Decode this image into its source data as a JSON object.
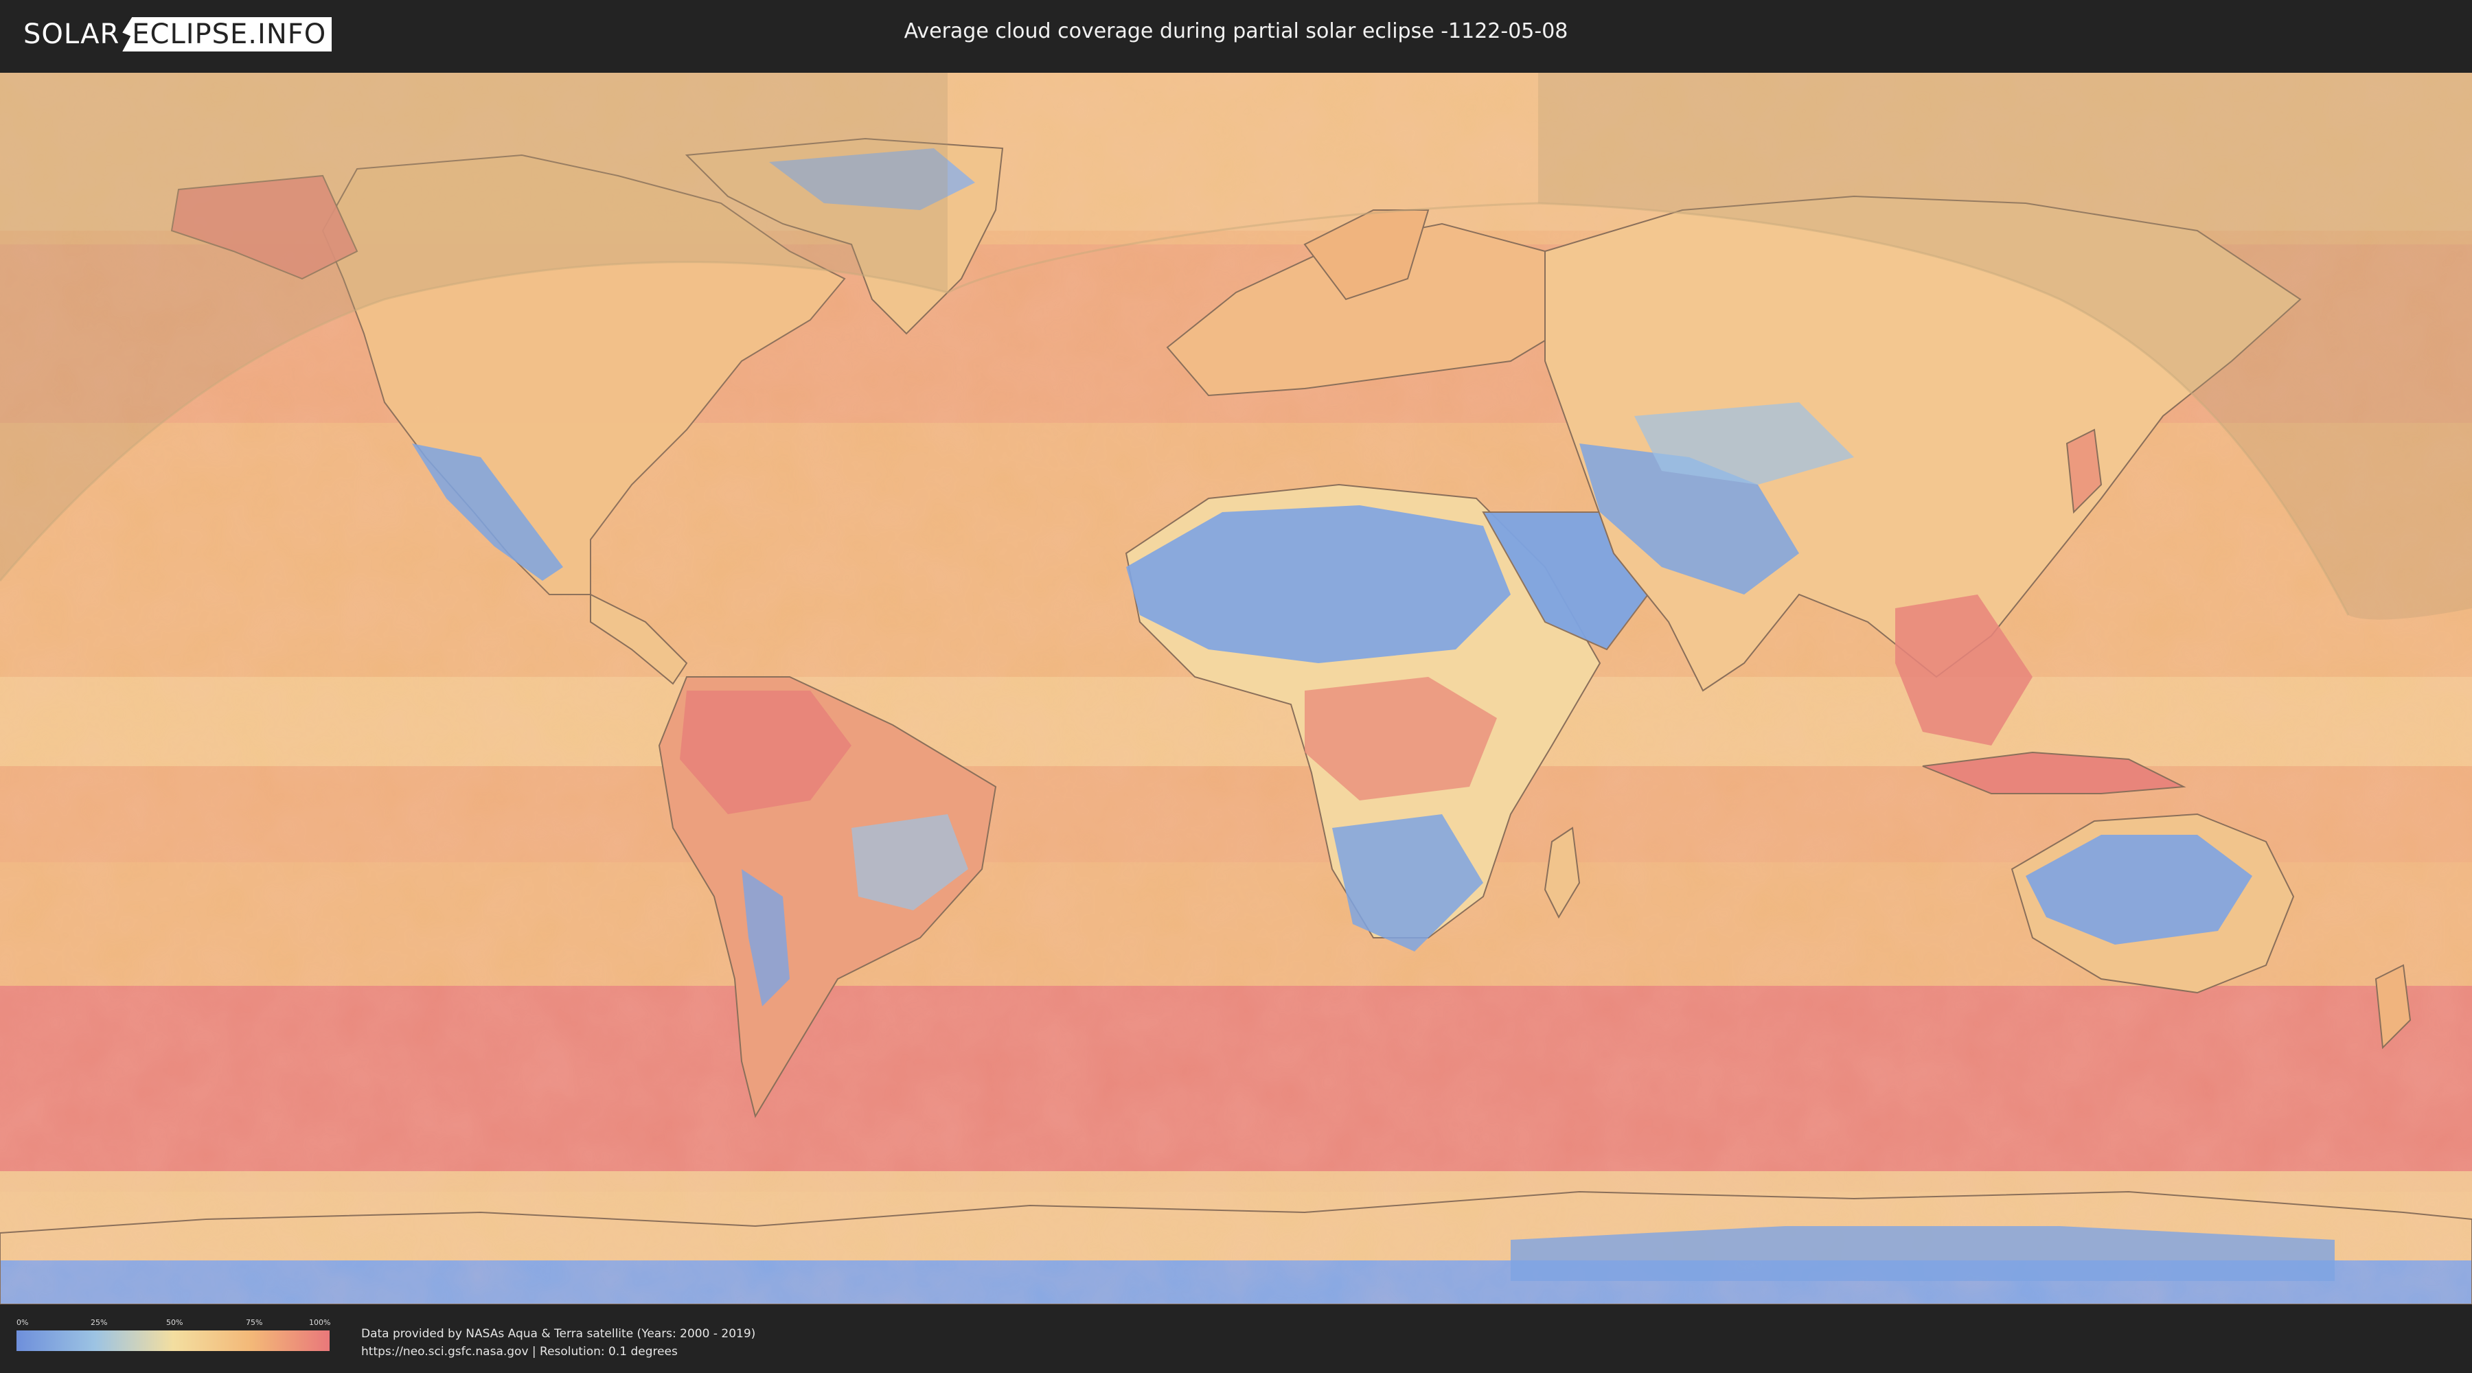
{
  "header": {
    "logo_left": "SOLAR",
    "logo_right": "ECLIPSE.INFO",
    "title": "Average cloud coverage during partial solar eclipse -1122-05-08"
  },
  "legend": {
    "ticks": [
      "0%",
      "25%",
      "50%",
      "75%",
      "100%"
    ],
    "colors": [
      "#6e8fdb",
      "#9cc3e3",
      "#f3dea0",
      "#f3b878",
      "#e9787a"
    ]
  },
  "credits": {
    "line1": "Data provided by NASAs Aqua & Terra satellite (Years: 2000 - 2019)",
    "line2": "https://neo.sci.gsfc.nasa.gov | Resolution: 0.1 degrees"
  },
  "map": {
    "projection": "equirectangular",
    "layer": "cloud-coverage",
    "eclipse_visibility": "partial",
    "colors": {
      "ocean_base": "#f0b07e",
      "high_cloud": "#e8807c",
      "medium_cloud": "#f3c98c",
      "low_cloud": "#f4dfa2",
      "clear": "#7ea4e2",
      "eclipse_shadow": "#b49a74",
      "border": "#8a6f5a"
    }
  }
}
